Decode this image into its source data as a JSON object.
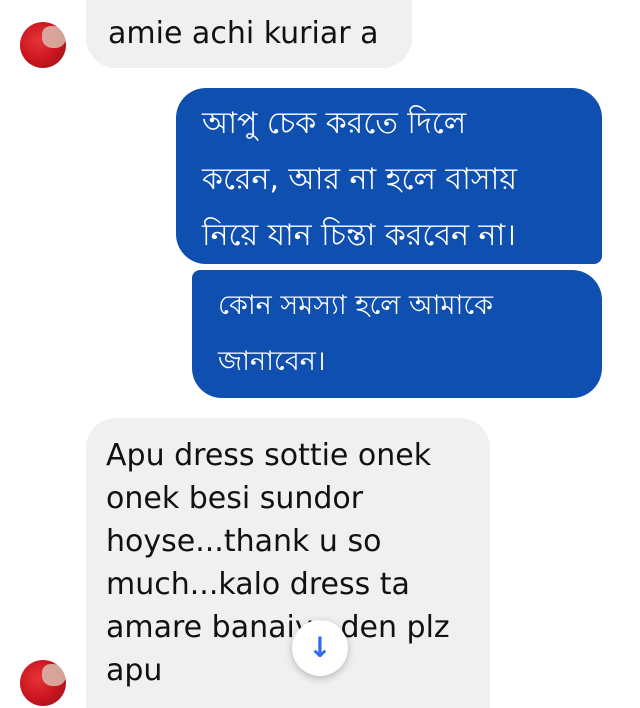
{
  "messages": [
    {
      "sender": "them",
      "text": "amie achi kuriar a"
    },
    {
      "sender": "me",
      "text": "আপু চেক করতে দিলে\nকরেন, আর না হলে বাসায়\nনিয়ে যান চিন্তা করবেন না।"
    },
    {
      "sender": "me",
      "text": "কোন সমস্যা হলে আমাকে\nজানাবেন।"
    },
    {
      "sender": "them",
      "text": "Apu dress sottie onek\nonek besi sundor\nhoyse...thank u so\nmuch...kalo dress ta\namare banaiya den plz\napu"
    }
  ],
  "scroll_button": {
    "icon": "↓"
  },
  "colors": {
    "incoming_bg": "#f0f0f0",
    "outgoing_bg": "#0f4fb0",
    "accent": "#2f6cf0"
  }
}
